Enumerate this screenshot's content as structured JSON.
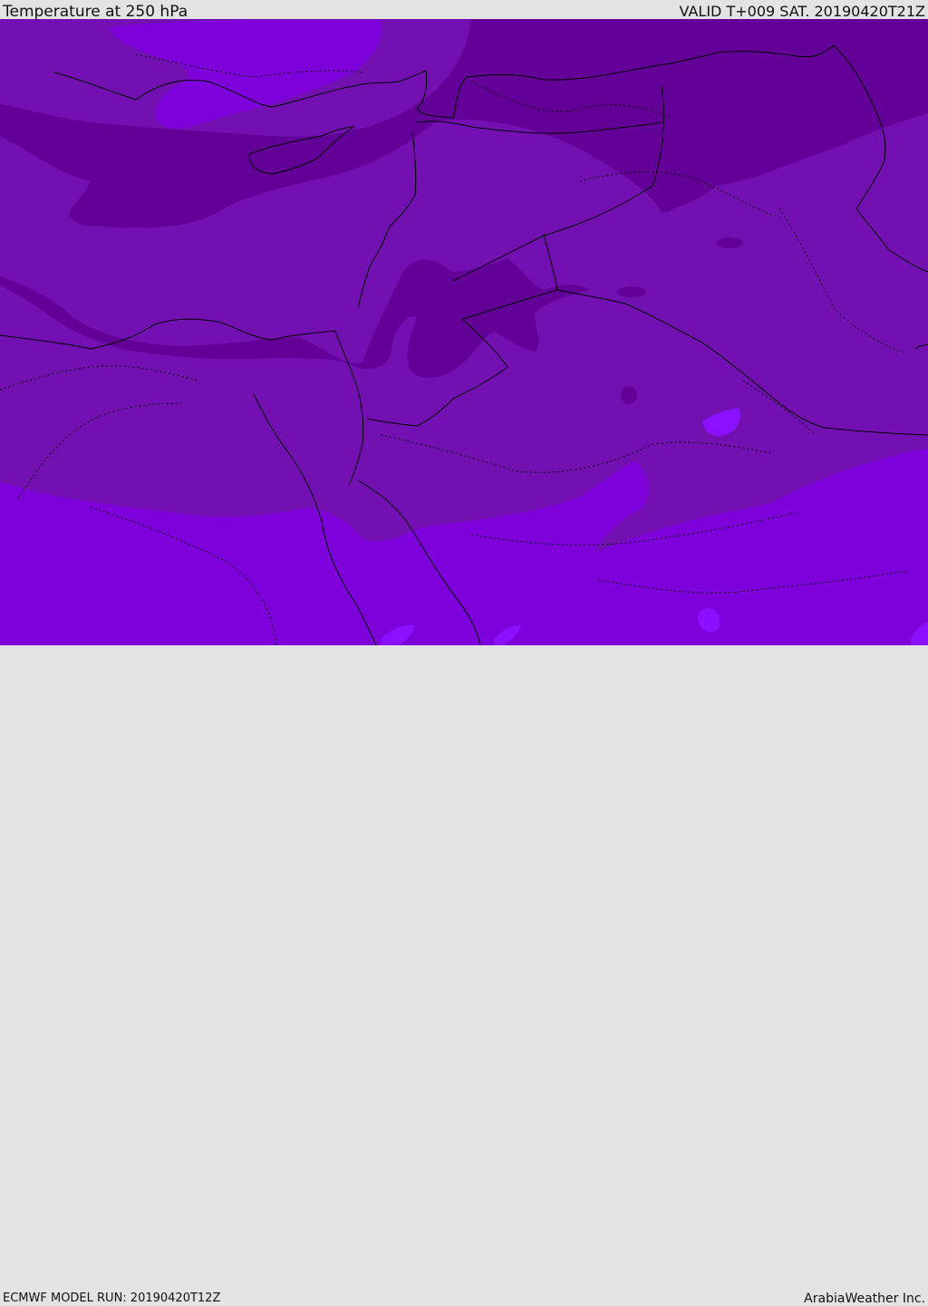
{
  "header": {
    "title": "Temperature at 250 hPa",
    "valid": "VALID T+009 SAT. 20190420T21Z"
  },
  "footer": {
    "model_run": "ECMWF MODEL RUN: 20190420T12Z",
    "credit": "ArabiaWeather Inc."
  },
  "colors": {
    "band_coldest": "#620097",
    "band_cold": "#7310b2",
    "band_mid": "#7e00da",
    "band_warm": "#8a10ff",
    "border_line": "#000000"
  }
}
